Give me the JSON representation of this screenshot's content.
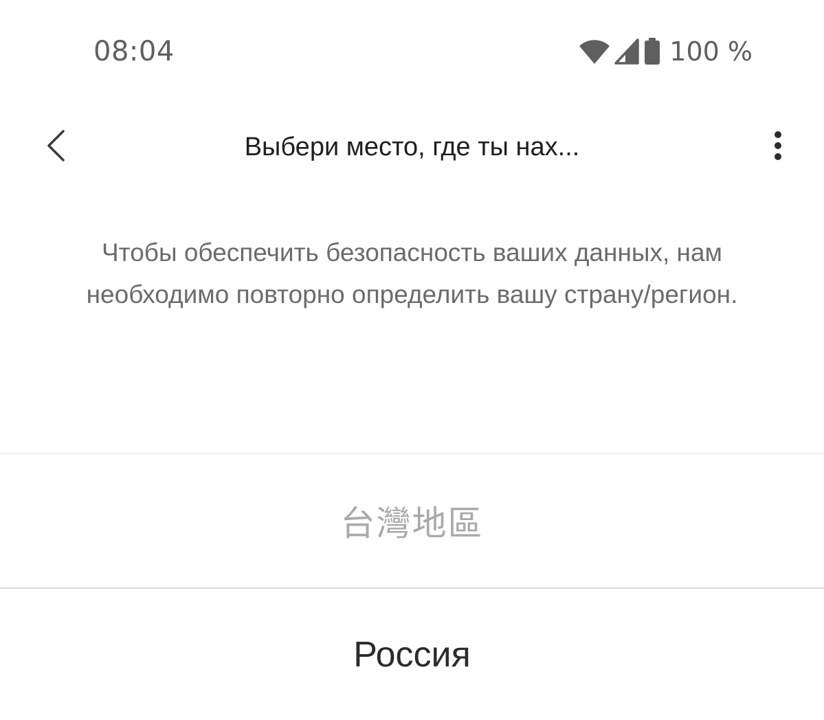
{
  "status_bar": {
    "time": "08:04",
    "battery_percent": "100 %",
    "icons": [
      "wifi-icon",
      "cell-signal-icon",
      "battery-icon"
    ]
  },
  "app_bar": {
    "title": "Выбери место, где ты нах...",
    "back_icon": "chevron-left-icon",
    "more_icon": "more-vert-icon"
  },
  "description": "Чтобы обеспечить безопасность ваших данных, нам необходимо повторно определить вашу страну/регион.",
  "regions": [
    {
      "label": "台灣地區"
    },
    {
      "label": "Россия"
    }
  ],
  "colors": {
    "background": "#ffffff",
    "title_text": "#1f1f1f",
    "body_text": "#6b6b6b",
    "muted_option": "#a9a9a9",
    "option_text": "#2b2b2b",
    "divider": "#e6e6e6"
  }
}
